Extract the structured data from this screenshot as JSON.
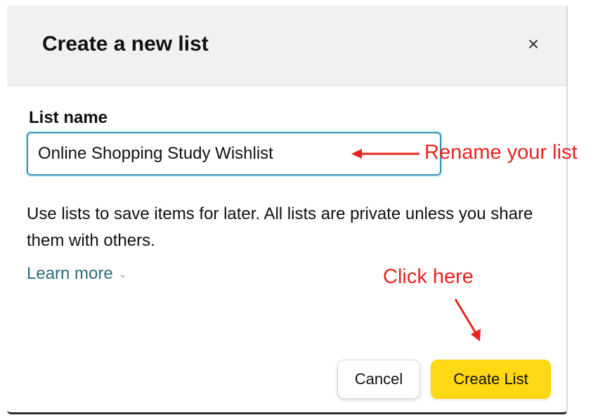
{
  "dialog": {
    "title": "Create a new list",
    "close_icon": "close-icon",
    "close_glyph": "×"
  },
  "form": {
    "list_name_label": "List name",
    "list_name_value": "Online Shopping Study Wishlist",
    "helper_text": "Use lists to save items for later. All lists are private unless you share them with others.",
    "learn_more_label": "Learn more",
    "learn_more_icon": "chevron-down-icon",
    "chevron_glyph": "⌄"
  },
  "actions": {
    "cancel_label": "Cancel",
    "create_label": "Create List"
  },
  "annotations": {
    "rename_text": "Rename your list",
    "click_text": "Click here",
    "color": "#e8231f"
  },
  "colors": {
    "header_bg": "#f0f2f2",
    "input_border": "#3b8fb5",
    "primary_button": "#ffd814",
    "link": "#2b6b7a"
  }
}
